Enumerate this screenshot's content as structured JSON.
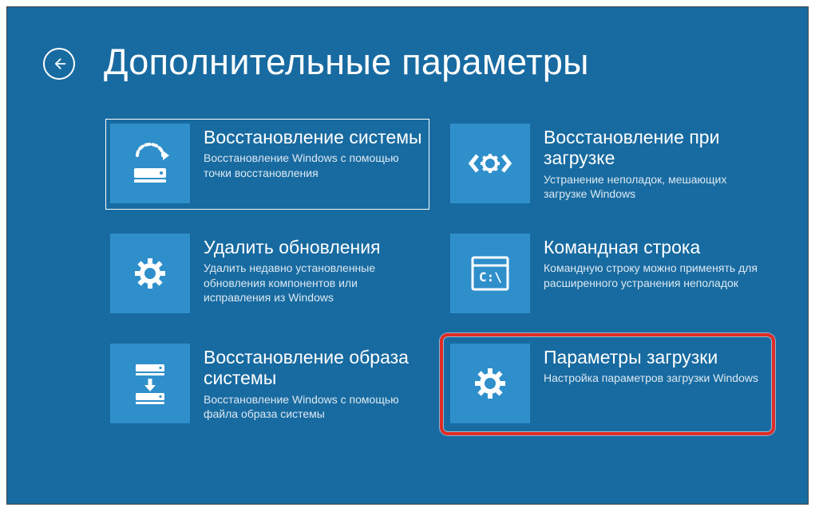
{
  "title": "Дополнительные параметры",
  "tiles": [
    {
      "icon": "system-restore-icon",
      "title": "Восстановление системы",
      "desc": "Восстановление Windows с помощью точки восстановления",
      "selected": true
    },
    {
      "icon": "startup-repair-icon",
      "title": "Восстановление при загрузке",
      "desc": "Устранение неполадок, мешающих загрузке Windows"
    },
    {
      "icon": "gear-icon",
      "title": "Удалить обновления",
      "desc": "Удалить недавно установленные обновления компонентов или исправления из Windows"
    },
    {
      "icon": "command-prompt-icon",
      "title": "Командная строка",
      "desc": "Командную строку можно применять для расширенного устранения неполадок"
    },
    {
      "icon": "image-recovery-icon",
      "title": "Восстановление образа системы",
      "desc": "Восстановление Windows с помощью файла образа системы"
    },
    {
      "icon": "gear-icon",
      "title": "Параметры загрузки",
      "desc": "Настройка параметров загрузки Windows",
      "highlighted": true
    }
  ]
}
